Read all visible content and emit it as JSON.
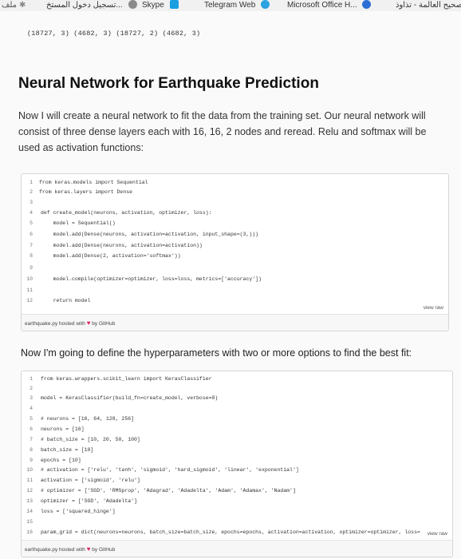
{
  "bookmarks": [
    {
      "label": "Microsoft Office H...",
      "color": "#2b6fd6"
    },
    {
      "label": "Telegram Web",
      "color": "#2aa3e0"
    },
    {
      "label": "Skype",
      "color": "#1a9fe0"
    },
    {
      "label": "تسجيل دخول المستخ...",
      "color": "#8a8a8a"
    },
    {
      "label": "صحيح العالمة - تذاوذ...",
      "color": "#6b6b6b"
    }
  ],
  "shapes_output": "(18727, 3) (4682, 3) (18727, 2) (4682, 3)",
  "title": "Neural Network for Earthquake Prediction",
  "intro": "Now I will create a neural network to fit the data from the training set. Our neural network will consist of three dense layers each with 16, 16, 2 nodes and reread. Relu and softmax will be used as activation functions:",
  "gist1": {
    "lines": [
      {
        "n": "1",
        "code": "from keras.models import Sequential"
      },
      {
        "n": "2",
        "code": "from keras.layers import Dense"
      },
      {
        "n": "3",
        "code": ""
      },
      {
        "n": "4",
        "code": "def create_model(neurons, activation, optimizer, loss):"
      },
      {
        "n": "5",
        "code": "    model = Sequential()"
      },
      {
        "n": "6",
        "code": "    model.add(Dense(neurons, activation=activation, input_shape=(3,)))"
      },
      {
        "n": "7",
        "code": "    model.add(Dense(neurons, activation=activation))"
      },
      {
        "n": "8",
        "code": "    model.add(Dense(2, activation='softmax'))"
      },
      {
        "n": "9",
        "code": ""
      },
      {
        "n": "10",
        "code": "    model.compile(optimizer=optimizer, loss=loss, metrics=['accuracy'])"
      },
      {
        "n": "11",
        "code": ""
      },
      {
        "n": "12",
        "code": "    return model"
      }
    ],
    "view_raw": "view raw",
    "file": "earthquake.py",
    "hosted": "hosted with",
    "by": "by GitHub"
  },
  "para2": "Now I'm going to define the hyperparameters with two or more options to find the best fit:",
  "gist2": {
    "lines": [
      {
        "n": "1",
        "code": "from keras.wrappers.scikit_learn import KerasClassifier"
      },
      {
        "n": "2",
        "code": ""
      },
      {
        "n": "3",
        "code": "model = KerasClassifier(build_fn=create_model, verbose=0)"
      },
      {
        "n": "4",
        "code": ""
      },
      {
        "n": "5",
        "code": "# neurons = [16, 64, 128, 256]"
      },
      {
        "n": "6",
        "code": "neurons = [16]"
      },
      {
        "n": "7",
        "code": "# batch_size = [10, 20, 50, 100]"
      },
      {
        "n": "8",
        "code": "batch_size = [10]"
      },
      {
        "n": "9",
        "code": "epochs = [10]"
      },
      {
        "n": "10",
        "code": "# activation = ['relu', 'tanh', 'sigmoid', 'hard_sigmoid', 'linear', 'exponential']"
      },
      {
        "n": "11",
        "code": "activation = ['sigmoid', 'relu']"
      },
      {
        "n": "12",
        "code": "# optimizer = ['SGD', 'RMSprop', 'Adagrad', 'Adadelta', 'Adam', 'Adamax', 'Nadam']"
      },
      {
        "n": "13",
        "code": "optimizer = ['SGD', 'Adadelta']"
      },
      {
        "n": "14",
        "code": "loss = ['squared_hinge']"
      },
      {
        "n": "15",
        "code": ""
      },
      {
        "n": "16",
        "code": "param_grid = dict(neurons=neurons, batch_size=batch_size, epochs=epochs, activation=activation, optimizer=optimizer, loss="
      }
    ],
    "view_raw": "view raw",
    "file": "earthquake.py",
    "hosted": "hosted with",
    "by": "by GitHub"
  }
}
